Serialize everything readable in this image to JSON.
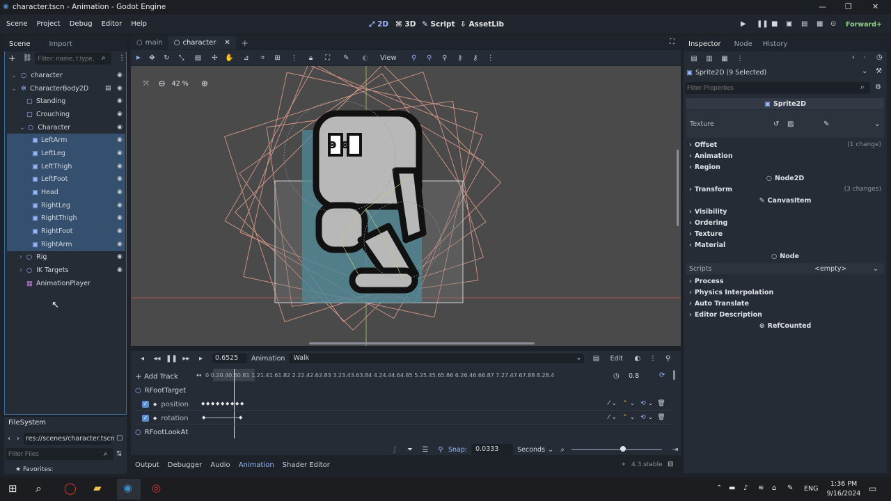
{
  "window": {
    "title": "character.tscn - Animation - Godot Engine"
  },
  "menu": [
    "Scene",
    "Project",
    "Debug",
    "Editor",
    "Help"
  ],
  "workspaces": [
    {
      "label": "2D"
    },
    {
      "label": "3D"
    },
    {
      "label": "Script"
    },
    {
      "label": "AssetLib"
    }
  ],
  "renderer": "Forward+",
  "scene_panel": {
    "tabs": [
      "Scene",
      "Import"
    ],
    "filter_placeholder": "Filter: name, t:type,",
    "tree": [
      {
        "label": "character"
      },
      {
        "label": "CharacterBody2D"
      },
      {
        "label": "Standing"
      },
      {
        "label": "Crouching"
      },
      {
        "label": "Character"
      },
      {
        "label": "LeftArm"
      },
      {
        "label": "LeftLeg"
      },
      {
        "label": "LeftThigh"
      },
      {
        "label": "LeftFoot"
      },
      {
        "label": "Head"
      },
      {
        "label": "RightLeg"
      },
      {
        "label": "RightThigh"
      },
      {
        "label": "RightFoot"
      },
      {
        "label": "RightArm"
      },
      {
        "label": "Rig"
      },
      {
        "label": "IK Targets"
      },
      {
        "label": "AnimationPlayer"
      }
    ]
  },
  "filesystem": {
    "title": "FileSystem",
    "path": "res://scenes/character.tscn",
    "filter_placeholder": "Filter Files",
    "favorites": "Favorites:"
  },
  "editor_tabs": [
    {
      "label": "main"
    },
    {
      "label": "character"
    }
  ],
  "viewport": {
    "zoom": "42 %",
    "view_menu": "View"
  },
  "animation": {
    "time": "0.6525",
    "label": "Animation",
    "name": "Walk",
    "edit": "Edit",
    "add_track": "Add Track",
    "ruler": "0  0.20.40.60.81  1.21.41.61.82  2.22.42.62.83  3.23.43.63.84  4.24.44.64.85  5.25.45.65.86  6.26.46.66.87  7.27.47.67.88  8.28.4",
    "length": "0.8",
    "tracks": [
      {
        "label": "RFootTarget"
      },
      {
        "label": "position"
      },
      {
        "label": "rotation"
      },
      {
        "label": "RFootLookAt"
      }
    ],
    "snap_label": "Snap:",
    "snap_value": "0.0333",
    "snap_unit": "Seconds"
  },
  "bottom_tabs": [
    "Output",
    "Debugger",
    "Audio",
    "Animation",
    "Shader Editor"
  ],
  "version": "4.3.stable",
  "inspector": {
    "tabs": [
      "Inspector",
      "Node",
      "History"
    ],
    "selection": "Sprite2D (9 Selected)",
    "filter_placeholder": "Filter Properties",
    "sprite_header": "Sprite2D",
    "texture_label": "Texture",
    "rows": [
      {
        "label": "Offset",
        "note": "(1 change)"
      },
      {
        "label": "Animation",
        "note": ""
      },
      {
        "label": "Region",
        "note": ""
      }
    ],
    "node2d_header": "Node2D",
    "transform": {
      "label": "Transform",
      "note": "(3 changes)"
    },
    "canvas_header": "CanvasItem",
    "canvas_rows": [
      "Visibility",
      "Ordering",
      "Texture",
      "Material"
    ],
    "node_header": "Node",
    "scripts_label": "Scripts",
    "scripts_value": "<empty>",
    "node_rows": [
      "Process",
      "Physics Interpolation",
      "Auto Translate",
      "Editor Description"
    ],
    "refcounted": "RefCounted"
  },
  "taskbar": {
    "lang": "ENG",
    "time": "1:36 PM",
    "date": "9/16/2024"
  }
}
